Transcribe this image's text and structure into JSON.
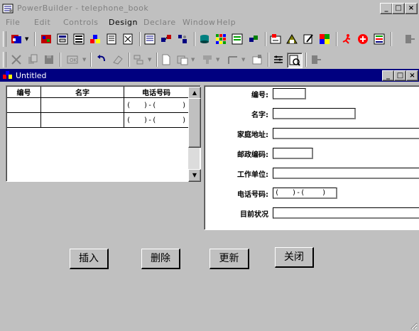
{
  "window": {
    "title": "PowerBuilder - telephone_book"
  },
  "menu": [
    {
      "label": "File",
      "active": false
    },
    {
      "label": "Edit",
      "active": false
    },
    {
      "label": "Controls",
      "active": false
    },
    {
      "label": "Design",
      "active": true
    },
    {
      "label": "Declare",
      "active": false
    },
    {
      "label": "Window",
      "active": false
    },
    {
      "label": "Help",
      "active": false
    }
  ],
  "toolbar1_icons": [
    "new-icon",
    "open-icon",
    "save-icon",
    "window-painter-icon",
    "menu-painter-icon",
    "datawindow-painter-icon",
    "structure-icon",
    "preview-icon",
    "query-icon",
    "function-icon",
    "library-icon",
    "run-icon",
    "database-icon",
    "pipeline-icon",
    "user-object-icon",
    "application-icon",
    "debug-icon",
    "script-icon",
    "color-icon",
    "exit-icon"
  ],
  "toolbar2_icons": [
    "cut-icon",
    "copy-icon",
    "paste-icon",
    "ok-icon",
    "undo-icon",
    "eraser-icon",
    "align-icon",
    "page-icon",
    "control-icon",
    "style-icon",
    "arrow-tool-icon",
    "property-icon",
    "grid-icon",
    "preview-data-icon",
    "close-tool-icon"
  ],
  "sheet": {
    "title": "Untitled"
  },
  "grid": {
    "columns": [
      "编号",
      "名字",
      "电话号码"
    ],
    "rows": [
      [
        "",
        "",
        "(   )-(      )"
      ],
      [
        "",
        "",
        "(   )-(      )"
      ]
    ]
  },
  "form": {
    "fields": [
      {
        "label": "编号:",
        "value": ""
      },
      {
        "label": "名字:",
        "value": ""
      },
      {
        "label": "家庭地址:",
        "value": ""
      },
      {
        "label": "邮政编码:",
        "value": ""
      },
      {
        "label": "工作单位:",
        "value": ""
      },
      {
        "label": "电话号码:",
        "value": "(   )-(    )"
      },
      {
        "label": "目前状况",
        "value": ""
      }
    ]
  },
  "buttons": {
    "insert": "插入",
    "delete": "删除",
    "update": "更新",
    "close": "关闭"
  },
  "caption_symbols": {
    "minimize": "_",
    "maximize": "□",
    "close": "×"
  }
}
